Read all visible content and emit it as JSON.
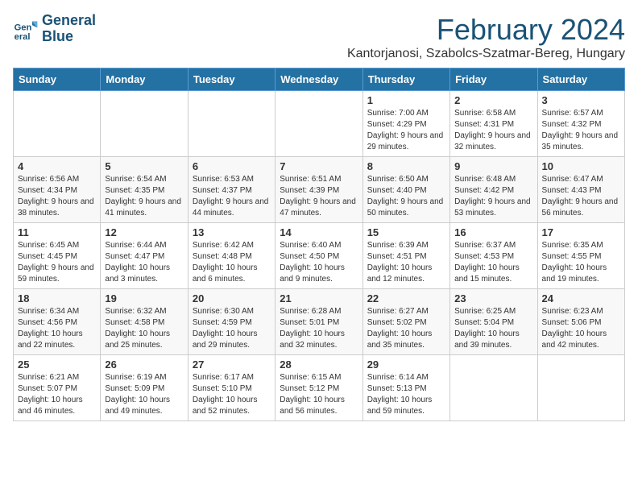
{
  "logo": {
    "line1": "General",
    "line2": "Blue"
  },
  "title": "February 2024",
  "subtitle": "Kantorjanosi, Szabolcs-Szatmar-Bereg, Hungary",
  "days": [
    "Sunday",
    "Monday",
    "Tuesday",
    "Wednesday",
    "Thursday",
    "Friday",
    "Saturday"
  ],
  "weeks": [
    [
      {
        "date": "",
        "sunrise": "",
        "sunset": "",
        "daylight": ""
      },
      {
        "date": "",
        "sunrise": "",
        "sunset": "",
        "daylight": ""
      },
      {
        "date": "",
        "sunrise": "",
        "sunset": "",
        "daylight": ""
      },
      {
        "date": "",
        "sunrise": "",
        "sunset": "",
        "daylight": ""
      },
      {
        "date": "1",
        "sunrise": "Sunrise: 7:00 AM",
        "sunset": "Sunset: 4:29 PM",
        "daylight": "Daylight: 9 hours and 29 minutes."
      },
      {
        "date": "2",
        "sunrise": "Sunrise: 6:58 AM",
        "sunset": "Sunset: 4:31 PM",
        "daylight": "Daylight: 9 hours and 32 minutes."
      },
      {
        "date": "3",
        "sunrise": "Sunrise: 6:57 AM",
        "sunset": "Sunset: 4:32 PM",
        "daylight": "Daylight: 9 hours and 35 minutes."
      }
    ],
    [
      {
        "date": "4",
        "sunrise": "Sunrise: 6:56 AM",
        "sunset": "Sunset: 4:34 PM",
        "daylight": "Daylight: 9 hours and 38 minutes."
      },
      {
        "date": "5",
        "sunrise": "Sunrise: 6:54 AM",
        "sunset": "Sunset: 4:35 PM",
        "daylight": "Daylight: 9 hours and 41 minutes."
      },
      {
        "date": "6",
        "sunrise": "Sunrise: 6:53 AM",
        "sunset": "Sunset: 4:37 PM",
        "daylight": "Daylight: 9 hours and 44 minutes."
      },
      {
        "date": "7",
        "sunrise": "Sunrise: 6:51 AM",
        "sunset": "Sunset: 4:39 PM",
        "daylight": "Daylight: 9 hours and 47 minutes."
      },
      {
        "date": "8",
        "sunrise": "Sunrise: 6:50 AM",
        "sunset": "Sunset: 4:40 PM",
        "daylight": "Daylight: 9 hours and 50 minutes."
      },
      {
        "date": "9",
        "sunrise": "Sunrise: 6:48 AM",
        "sunset": "Sunset: 4:42 PM",
        "daylight": "Daylight: 9 hours and 53 minutes."
      },
      {
        "date": "10",
        "sunrise": "Sunrise: 6:47 AM",
        "sunset": "Sunset: 4:43 PM",
        "daylight": "Daylight: 9 hours and 56 minutes."
      }
    ],
    [
      {
        "date": "11",
        "sunrise": "Sunrise: 6:45 AM",
        "sunset": "Sunset: 4:45 PM",
        "daylight": "Daylight: 9 hours and 59 minutes."
      },
      {
        "date": "12",
        "sunrise": "Sunrise: 6:44 AM",
        "sunset": "Sunset: 4:47 PM",
        "daylight": "Daylight: 10 hours and 3 minutes."
      },
      {
        "date": "13",
        "sunrise": "Sunrise: 6:42 AM",
        "sunset": "Sunset: 4:48 PM",
        "daylight": "Daylight: 10 hours and 6 minutes."
      },
      {
        "date": "14",
        "sunrise": "Sunrise: 6:40 AM",
        "sunset": "Sunset: 4:50 PM",
        "daylight": "Daylight: 10 hours and 9 minutes."
      },
      {
        "date": "15",
        "sunrise": "Sunrise: 6:39 AM",
        "sunset": "Sunset: 4:51 PM",
        "daylight": "Daylight: 10 hours and 12 minutes."
      },
      {
        "date": "16",
        "sunrise": "Sunrise: 6:37 AM",
        "sunset": "Sunset: 4:53 PM",
        "daylight": "Daylight: 10 hours and 15 minutes."
      },
      {
        "date": "17",
        "sunrise": "Sunrise: 6:35 AM",
        "sunset": "Sunset: 4:55 PM",
        "daylight": "Daylight: 10 hours and 19 minutes."
      }
    ],
    [
      {
        "date": "18",
        "sunrise": "Sunrise: 6:34 AM",
        "sunset": "Sunset: 4:56 PM",
        "daylight": "Daylight: 10 hours and 22 minutes."
      },
      {
        "date": "19",
        "sunrise": "Sunrise: 6:32 AM",
        "sunset": "Sunset: 4:58 PM",
        "daylight": "Daylight: 10 hours and 25 minutes."
      },
      {
        "date": "20",
        "sunrise": "Sunrise: 6:30 AM",
        "sunset": "Sunset: 4:59 PM",
        "daylight": "Daylight: 10 hours and 29 minutes."
      },
      {
        "date": "21",
        "sunrise": "Sunrise: 6:28 AM",
        "sunset": "Sunset: 5:01 PM",
        "daylight": "Daylight: 10 hours and 32 minutes."
      },
      {
        "date": "22",
        "sunrise": "Sunrise: 6:27 AM",
        "sunset": "Sunset: 5:02 PM",
        "daylight": "Daylight: 10 hours and 35 minutes."
      },
      {
        "date": "23",
        "sunrise": "Sunrise: 6:25 AM",
        "sunset": "Sunset: 5:04 PM",
        "daylight": "Daylight: 10 hours and 39 minutes."
      },
      {
        "date": "24",
        "sunrise": "Sunrise: 6:23 AM",
        "sunset": "Sunset: 5:06 PM",
        "daylight": "Daylight: 10 hours and 42 minutes."
      }
    ],
    [
      {
        "date": "25",
        "sunrise": "Sunrise: 6:21 AM",
        "sunset": "Sunset: 5:07 PM",
        "daylight": "Daylight: 10 hours and 46 minutes."
      },
      {
        "date": "26",
        "sunrise": "Sunrise: 6:19 AM",
        "sunset": "Sunset: 5:09 PM",
        "daylight": "Daylight: 10 hours and 49 minutes."
      },
      {
        "date": "27",
        "sunrise": "Sunrise: 6:17 AM",
        "sunset": "Sunset: 5:10 PM",
        "daylight": "Daylight: 10 hours and 52 minutes."
      },
      {
        "date": "28",
        "sunrise": "Sunrise: 6:15 AM",
        "sunset": "Sunset: 5:12 PM",
        "daylight": "Daylight: 10 hours and 56 minutes."
      },
      {
        "date": "29",
        "sunrise": "Sunrise: 6:14 AM",
        "sunset": "Sunset: 5:13 PM",
        "daylight": "Daylight: 10 hours and 59 minutes."
      },
      {
        "date": "",
        "sunrise": "",
        "sunset": "",
        "daylight": ""
      },
      {
        "date": "",
        "sunrise": "",
        "sunset": "",
        "daylight": ""
      }
    ]
  ]
}
